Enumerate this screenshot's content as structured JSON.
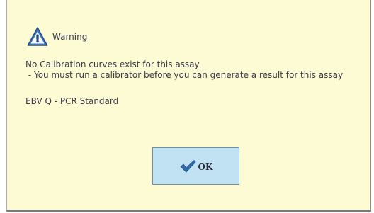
{
  "dialog": {
    "title": "Warning",
    "message_line1": "No Calibration curves exist for this assay",
    "message_line2": " - You must run a calibrator before you can generate a result for this assay",
    "assay_name": "EBV Q - PCR Standard",
    "ok_label": "OK"
  },
  "icons": {
    "warning": "warning-triangle-icon",
    "ok": "checkmark-icon"
  },
  "colors": {
    "dialog_background": "#fdfbd3",
    "button_background": "#c0e2f2",
    "icon_blue": "#3a78b8"
  }
}
